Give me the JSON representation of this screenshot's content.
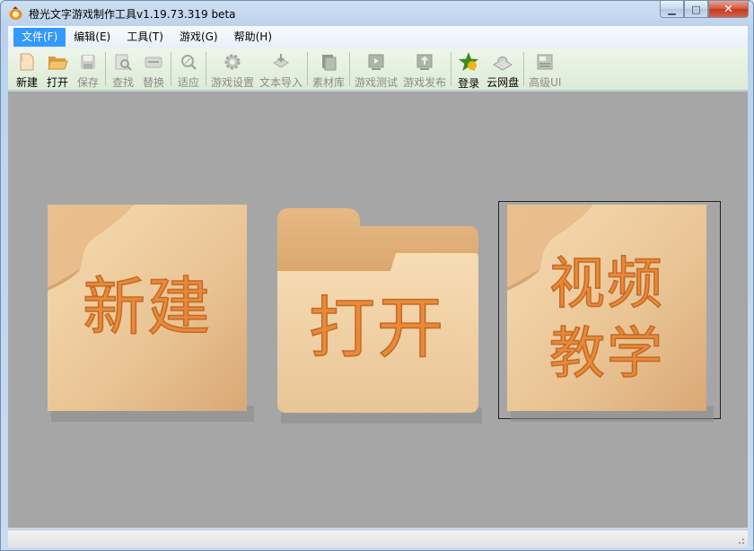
{
  "window": {
    "title": "橙光文字游戏制作工具v1.19.73.319 beta",
    "controls": {
      "minimize": "▁",
      "maximize": "□",
      "close": "✕"
    }
  },
  "menu": [
    {
      "label": "文件(F)",
      "active": true
    },
    {
      "label": "编辑(E)"
    },
    {
      "label": "工具(T)"
    },
    {
      "label": "游戏(G)"
    },
    {
      "label": "帮助(H)"
    }
  ],
  "toolbar": {
    "new": "新建",
    "open": "打开",
    "save": "保存",
    "find": "查找",
    "replace": "替换",
    "fit": "适应",
    "game_settings": "游戏设置",
    "text_import": "文本导入",
    "assets": "素材库",
    "game_test": "游戏测试",
    "game_publish": "游戏发布",
    "login": "登录",
    "cloud_drive": "云网盘",
    "advanced_ui": "高级UI"
  },
  "cards": {
    "new": {
      "line1": "新建"
    },
    "open": {
      "line1": "打开"
    },
    "tutorial": {
      "line1": "视频",
      "line2": "教学"
    }
  },
  "colors": {
    "workspace": "#a6a6a6",
    "card_label": "#e88a3a",
    "menu_active": "#3399ff"
  }
}
